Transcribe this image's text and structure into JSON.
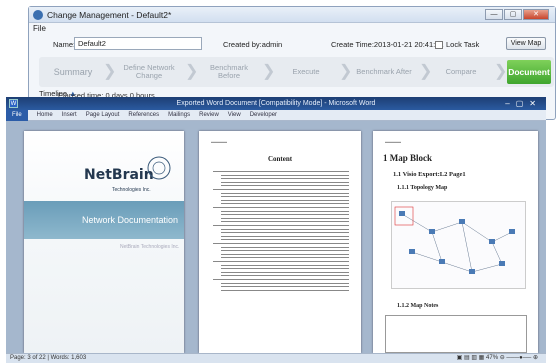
{
  "change_window": {
    "title": "Change Management - Default2*",
    "menu": "File",
    "name_label": "Name:",
    "name_value": "Default2",
    "created_by": "Created by:admin",
    "create_time": "Create Time:2013-01-21 20:41:31",
    "lock_task": "Lock Task",
    "view_map": "View Map",
    "steps": [
      "Summary",
      "Define Network Change",
      "Benchmark Before",
      "Execute",
      "Benchmark After",
      "Compare",
      "Document"
    ],
    "timeline": "Timeline",
    "elapsed": "Elapsed time: 0 days 0 hours"
  },
  "word": {
    "title": "Exported Word Document [Compatibility Mode] - Microsoft Word",
    "tabs": [
      "File",
      "Home",
      "Insert",
      "Page Layout",
      "References",
      "Mailings",
      "Review",
      "View",
      "Developer"
    ],
    "status_left": "Page: 3 of 22  |  Words: 1,603",
    "zoom": "47%",
    "cover": {
      "logo": "NetBrain",
      "logo_sub": "Technologies Inc.",
      "band": "Network Documentation",
      "company": "NetBrain Technologies Inc."
    },
    "toc_title": "Content",
    "page3": {
      "h1": "1  Map Block",
      "h2": "1.1  Visio Export:L2 Page1",
      "h3": "1.1.1  Topology Map",
      "h4": "1.1.2  Map Notes"
    }
  }
}
